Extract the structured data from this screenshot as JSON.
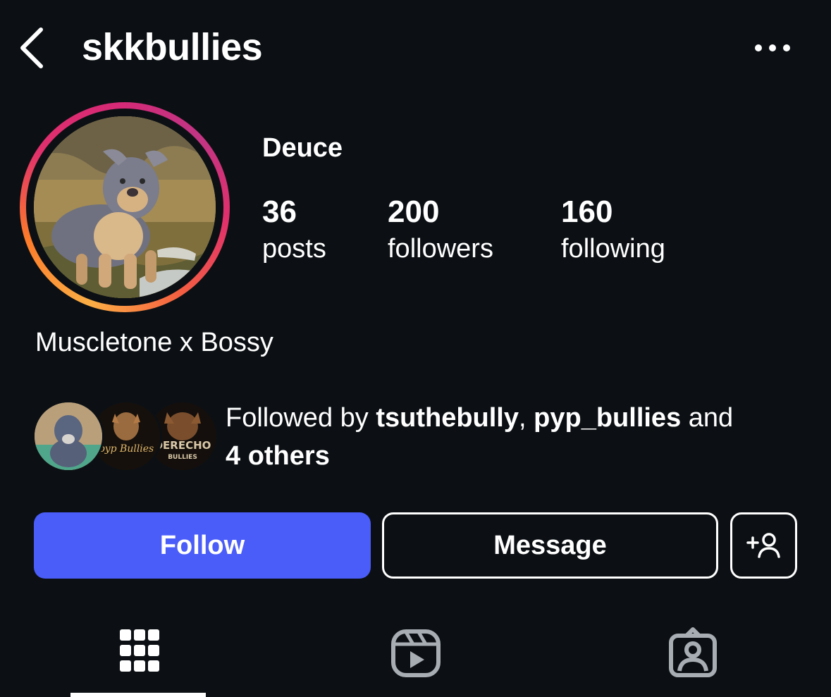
{
  "header": {
    "username": "skkbullies",
    "back_icon": "chevron-left-icon",
    "more_icon": "more-horizontal-icon"
  },
  "profile": {
    "display_name": "Deuce",
    "story_ring_colors": [
      "#fcaf45",
      "#e1306c",
      "#c13584"
    ],
    "stats": [
      {
        "value": "36",
        "label": "posts"
      },
      {
        "value": "200",
        "label": "followers"
      },
      {
        "value": "160",
        "label": "following"
      }
    ],
    "bio": "Muscletone x Bossy"
  },
  "followed_by": {
    "prefix": "Followed by ",
    "users": [
      "tsuthebully",
      "pyp_bullies"
    ],
    "separator": ", ",
    "conjunction": " and",
    "others": "4 others",
    "avatar_texts": [
      "pyp Bullies",
      "DERECHO",
      "BULLIES"
    ]
  },
  "actions": {
    "follow_label": "Follow",
    "message_label": "Message",
    "suggest_icon": "add-person-icon",
    "follow_color": "#4a5df9"
  },
  "tabs": [
    {
      "icon": "grid-icon",
      "active": true
    },
    {
      "icon": "reels-icon",
      "active": false
    },
    {
      "icon": "tagged-icon",
      "active": false
    }
  ]
}
